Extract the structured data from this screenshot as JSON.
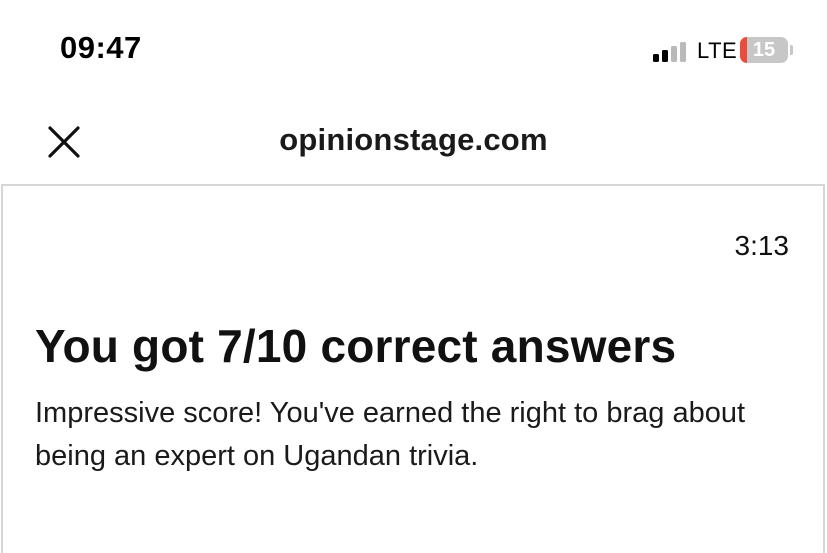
{
  "status_bar": {
    "time": "09:47",
    "network": "LTE",
    "battery_level": "15",
    "signal_icon": "cellular-signal-icon",
    "battery_icon": "battery-icon"
  },
  "browser": {
    "domain": "opinionstage.com",
    "close_icon": "close-icon"
  },
  "quiz": {
    "timer": "3:13",
    "result_title": "You got 7/10 correct answers",
    "result_description": "Impressive score! You've earned the right to brag about being an expert on Ugandan trivia."
  },
  "colors": {
    "battery_low": "#eb4d3d",
    "battery_body": "#c7c7c7",
    "card_border": "#d6d6d6"
  }
}
